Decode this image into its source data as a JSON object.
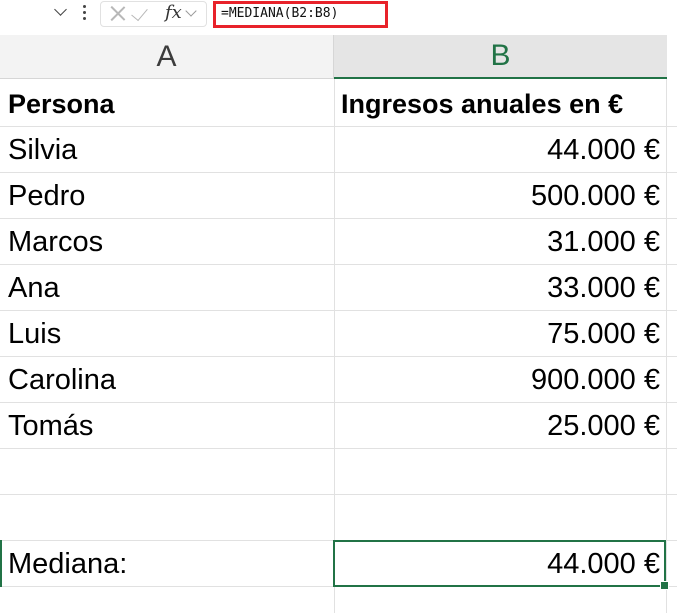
{
  "formula_bar": {
    "fx": "fx",
    "formula": "=MEDIANA(B2:B8)",
    "icons": [
      "chevron-down-icon",
      "more-vertical-icon",
      "cancel-icon",
      "enter-icon",
      "fx-icon"
    ]
  },
  "columns": [
    "A",
    "B"
  ],
  "header_row": {
    "a": "Persona",
    "b": "Ingresos anuales en €"
  },
  "rows": [
    {
      "a": "Silvia",
      "b": "44.000 €"
    },
    {
      "a": "Pedro",
      "b": "500.000 €"
    },
    {
      "a": "Marcos",
      "b": "31.000 €"
    },
    {
      "a": "Ana",
      "b": "33.000 €"
    },
    {
      "a": "Luis",
      "b": "75.000 €"
    },
    {
      "a": "Carolina",
      "b": "900.000 €"
    },
    {
      "a": "Tomás",
      "b": "25.000 €"
    }
  ],
  "result_row": {
    "a": "Mediana:",
    "b": "44.000 €"
  },
  "colors": {
    "accent": "#217346",
    "highlight_border": "#e8222a"
  }
}
